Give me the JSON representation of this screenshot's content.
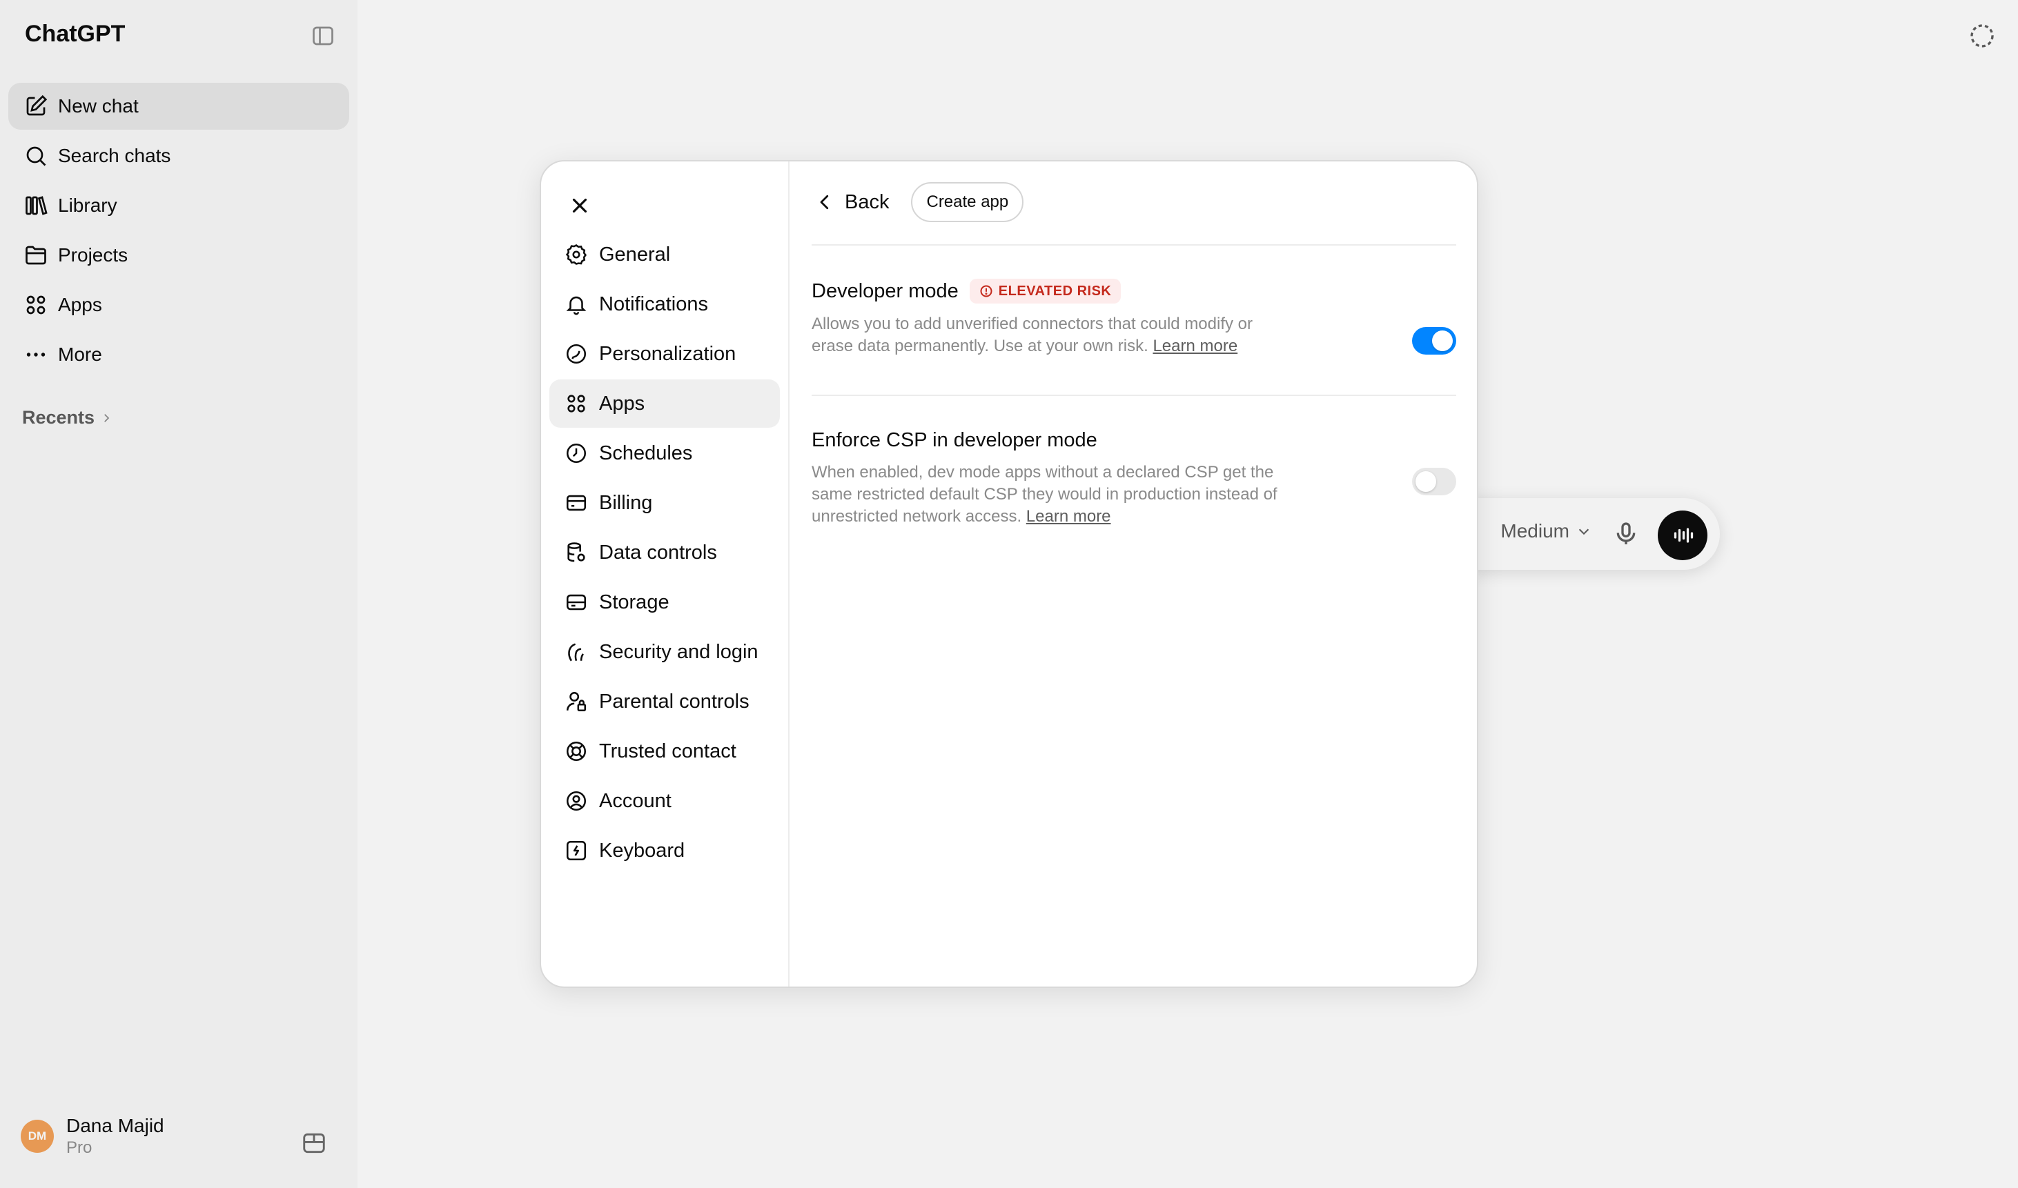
{
  "app": {
    "brand": "ChatGPT",
    "sidebar": {
      "items": [
        {
          "label": "New chat",
          "icon": "edit-icon"
        },
        {
          "label": "Search chats",
          "icon": "search-icon"
        },
        {
          "label": "Library",
          "icon": "library-icon"
        },
        {
          "label": "Projects",
          "icon": "folder-icon"
        },
        {
          "label": "Apps",
          "icon": "apps-icon"
        },
        {
          "label": "More",
          "icon": "more-icon"
        }
      ],
      "recents_label": "Recents"
    },
    "user": {
      "initials": "DM",
      "name": "Dana Majid",
      "plan": "Pro"
    },
    "composer": {
      "model_label": "Medium"
    }
  },
  "settings_modal": {
    "nav": [
      {
        "label": "General",
        "icon": "gear-icon"
      },
      {
        "label": "Notifications",
        "icon": "bell-icon"
      },
      {
        "label": "Personalization",
        "icon": "personalization-icon"
      },
      {
        "label": "Apps",
        "icon": "apps-icon"
      },
      {
        "label": "Schedules",
        "icon": "clock-icon"
      },
      {
        "label": "Billing",
        "icon": "card-icon"
      },
      {
        "label": "Data controls",
        "icon": "database-icon"
      },
      {
        "label": "Storage",
        "icon": "storage-icon"
      },
      {
        "label": "Security and login",
        "icon": "security-icon"
      },
      {
        "label": "Parental controls",
        "icon": "parental-icon"
      },
      {
        "label": "Trusted contact",
        "icon": "lifebuoy-icon"
      },
      {
        "label": "Account",
        "icon": "account-icon"
      },
      {
        "label": "Keyboard",
        "icon": "keyboard-icon"
      }
    ],
    "active_nav": "Apps",
    "header": {
      "back_label": "Back",
      "create_label": "Create app"
    },
    "settings": [
      {
        "title": "Developer mode",
        "badge": "ELEVATED RISK",
        "description": "Allows you to add unverified connectors that could modify or erase data permanently. Use at your own risk.",
        "link": "Learn more",
        "enabled": true
      },
      {
        "title": "Enforce CSP in developer mode",
        "description": "When enabled, dev mode apps without a declared CSP get the same restricted default CSP they would in production instead of unrestricted network access.",
        "link": "Learn more",
        "enabled": false
      }
    ],
    "colors": {
      "toggle_on": "#0285ff",
      "toggle_off": "#e8e8e8",
      "risk": "#c4291c"
    }
  }
}
